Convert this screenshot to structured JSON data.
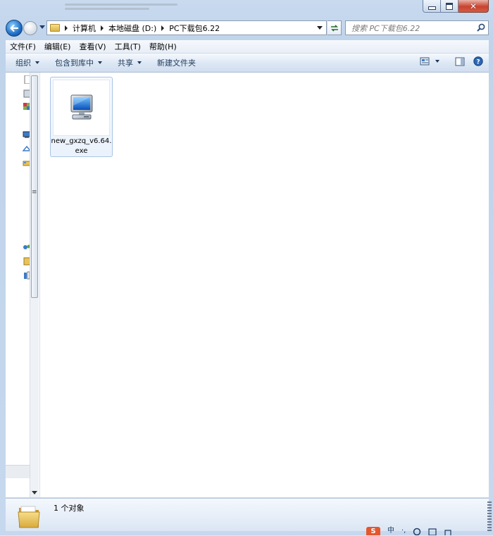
{
  "window": {
    "minimize_icon": "minimize-icon",
    "maximize_icon": "maximize-icon",
    "close_icon": "close-icon"
  },
  "nav": {
    "breadcrumbs": [
      {
        "label": "计算机"
      },
      {
        "label": "本地磁盘 (D:)"
      },
      {
        "label": "PC下载包6.22"
      }
    ],
    "search_placeholder": "搜索 PC下载包6.22"
  },
  "menu": {
    "items": [
      "文件(F)",
      "编辑(E)",
      "查看(V)",
      "工具(T)",
      "帮助(H)"
    ]
  },
  "commands": {
    "organize": "组织",
    "include_in_library": "包含到库中",
    "share": "共享",
    "new_folder": "新建文件夹"
  },
  "files": [
    {
      "name": "new_gxzq_v6.64.exe",
      "icon": "computer-icon"
    }
  ],
  "status": {
    "count_text": "1 个对象"
  },
  "tray": {
    "badge": "S",
    "lang": "中",
    "sym": "·,"
  },
  "colors": {
    "accent": "#1f6fc6",
    "selection": "#a9c4e4",
    "close_red": "#c8432f"
  }
}
